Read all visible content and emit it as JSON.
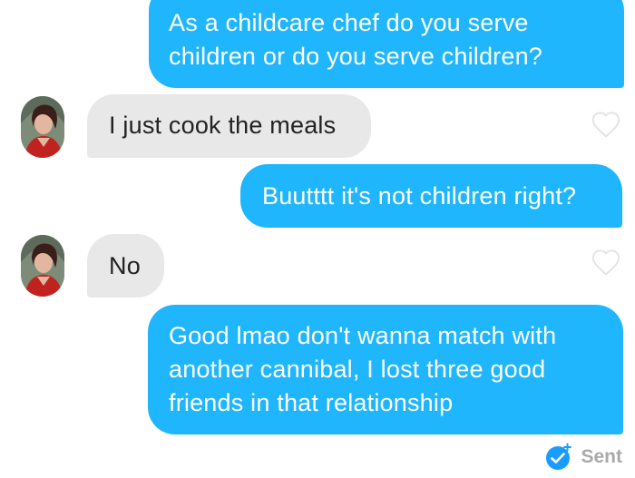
{
  "messages": [
    {
      "direction": "out",
      "text": "As a childcare chef do you serve\nchildren or do you serve children?"
    },
    {
      "direction": "in",
      "text": "I just cook the meals"
    },
    {
      "direction": "out",
      "text": "Buutttt it's not children right?"
    },
    {
      "direction": "in",
      "text": "No"
    },
    {
      "direction": "out",
      "text": "Good lmao don't wanna match with\nanother cannibal, I lost three good\nfriends in that relationship"
    }
  ],
  "status": {
    "label": "Sent",
    "icon": "check-badge-icon"
  },
  "colors": {
    "outgoing_bubble": "#1fb6fd",
    "incoming_bubble": "#e8e8e8",
    "status_text": "#a9a9a9",
    "check_badge": "#1a9cff"
  }
}
